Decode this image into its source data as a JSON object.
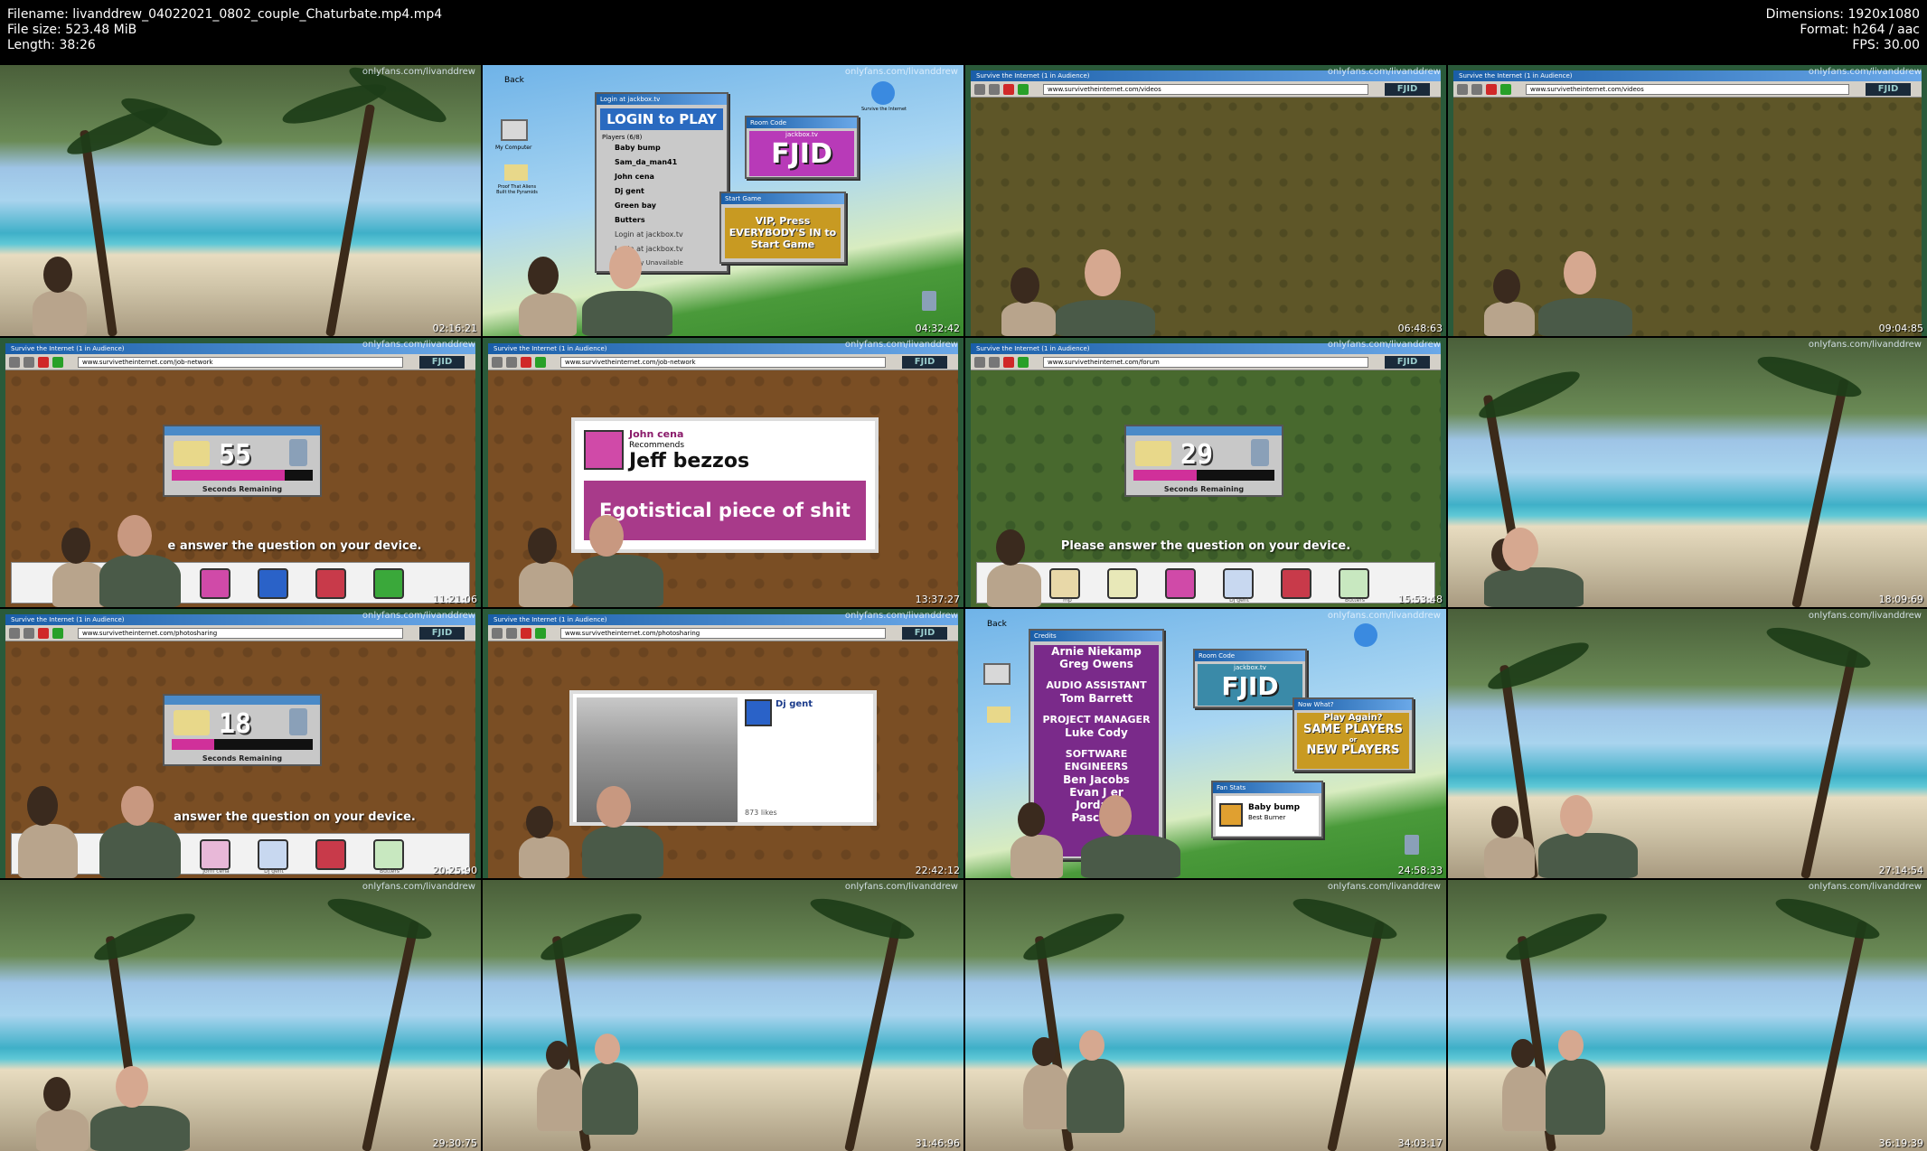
{
  "meta": {
    "filename": "Filename: livanddrew_04022021_0802_couple_Chaturbate.mp4.mp4",
    "filesize": "File size: 523.48 MiB",
    "length": "Length: 38:26",
    "dimensions": "Dimensions: 1920x1080",
    "format": "Format: h264 / aac",
    "fps": "FPS: 30.00"
  },
  "watermark": "onlyfans.com/livanddrew",
  "browser": {
    "title": "Survive the Internet  (1 in Audience)",
    "logo": "FJID",
    "url_videos": "www.survivetheinternet.com/videos",
    "url_job": "www.survivetheinternet.com/job-network",
    "url_forum": "www.survivetheinternet.com/forum",
    "url_photo": "www.survivetheinternet.com/photosharing"
  },
  "thumbs": [
    {
      "ts": "02:16:21"
    },
    {
      "ts": "04:32:42"
    },
    {
      "ts": "06:48:63"
    },
    {
      "ts": "09:04:85"
    },
    {
      "ts": "11:21:06"
    },
    {
      "ts": "13:37:27"
    },
    {
      "ts": "15:53:48"
    },
    {
      "ts": "18:09:69"
    },
    {
      "ts": "20:25:90"
    },
    {
      "ts": "22:42:12"
    },
    {
      "ts": "24:58:33"
    },
    {
      "ts": "27:14:54"
    },
    {
      "ts": "29:30:75"
    },
    {
      "ts": "31:46:96"
    },
    {
      "ts": "34:03:17"
    },
    {
      "ts": "36:19:39"
    }
  ],
  "lobby": {
    "back": "Back",
    "login_title": "LOGIN to PLAY",
    "login_bar": "Login at jackbox.tv",
    "players_header": "Players (6/8)",
    "players": [
      "Baby bump",
      "Sam_da_man41",
      "John cena",
      "Dj gent",
      "Green bay",
      "Butters"
    ],
    "login_line1": "Login at jackbox.tv",
    "login_line2": "Login at jackbox.tv",
    "unavailable": "Currently Unavailable",
    "room_code_bar": "Room Code",
    "room_site": "jackbox.tv",
    "room_code": "FJID",
    "start_bar": "Start Game",
    "start_text": "VIP, Press EVERYBODY'S IN to Start Game",
    "my_computer": "My Computer",
    "proof": "Proof That Aliens Built the Pyramids",
    "survive": "Survive the Internet"
  },
  "timers": {
    "label": "Seconds Remaining",
    "bar": "Timer",
    "t1": "55",
    "t2": "29",
    "t3": "18",
    "fill1": 0.8,
    "fill2": 0.45,
    "fill3": 0.3
  },
  "prompts": {
    "p1": "e answer the question on your device.",
    "p2": "Please answer the question on your device.",
    "p3": "answer the question on your device."
  },
  "tray_names": {
    "n1": "mp",
    "n2": "Dj gent",
    "n3": "Butters",
    "n4": "John cena",
    "n5": "Dj gent",
    "n6": "Butters"
  },
  "recommend": {
    "name": "John cena",
    "sub": "Recommends",
    "target": "Jeff bezzos",
    "quote": "Egotistical piece of shit"
  },
  "photo": {
    "name": "Dj gent",
    "likes": "873 likes"
  },
  "credits": {
    "bar": "Credits",
    "lines": [
      "Arnie Niekamp",
      "Greg Owens",
      "AUDIO ASSISTANT",
      "Tom Barrett",
      "PROJECT MANAGER",
      "Luke Cody",
      "SOFTWARE ENGINEERS",
      "Ben Jacobs",
      "Evan J  er",
      "Jorda   r",
      "Pasca   el"
    ],
    "room_bar": "Room Code",
    "room_site": "jackbox.tv",
    "room_code": "FJID",
    "next_bar": "Now What?",
    "play_again": "Play Again?",
    "same": "SAME PLAYERS",
    "or": "or",
    "new": "NEW PLAYERS",
    "fan_bar": "Fan Stats",
    "fan_name": "Baby bump",
    "fan_award": "Best Burner",
    "back": "Back"
  },
  "colors": {
    "titlebar": "#1a5ea8",
    "timer_fill": "#d0309a",
    "room_code_bg": "#b83ab8",
    "start_bg": "#c89a22"
  }
}
